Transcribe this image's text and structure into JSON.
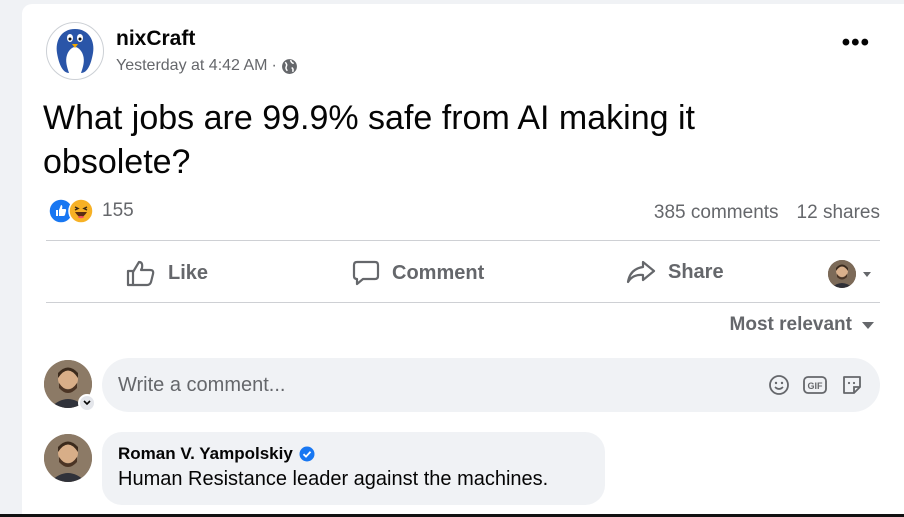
{
  "post": {
    "page_name": "nixCraft",
    "time": "Yesterday at 4:42 AM",
    "separator": "·",
    "audience_icon": "globe-icon",
    "more_label": "•••",
    "text": "What jobs are 99.9% safe from AI making it obsolete?",
    "reaction_icons": [
      "like-reaction-icon",
      "haha-reaction-icon"
    ],
    "reaction_count": "155",
    "comments_count": "385 comments",
    "shares_count": "12 shares"
  },
  "actions": {
    "like": "Like",
    "comment": "Comment",
    "share": "Share"
  },
  "comments": {
    "sort_label": "Most relevant",
    "input_placeholder": "Write a comment...",
    "tool_icons": [
      "emoji-icon",
      "gif-icon",
      "sticker-icon"
    ],
    "gif_label": "GIF",
    "items": [
      {
        "author": "Roman V. Yampolskiy",
        "verified": true,
        "text": "Human Resistance leader against the machines."
      }
    ]
  },
  "colors": {
    "brand_blue": "#1877f2",
    "secondary_text": "#65676b",
    "bubble_bg": "#f0f2f5"
  }
}
